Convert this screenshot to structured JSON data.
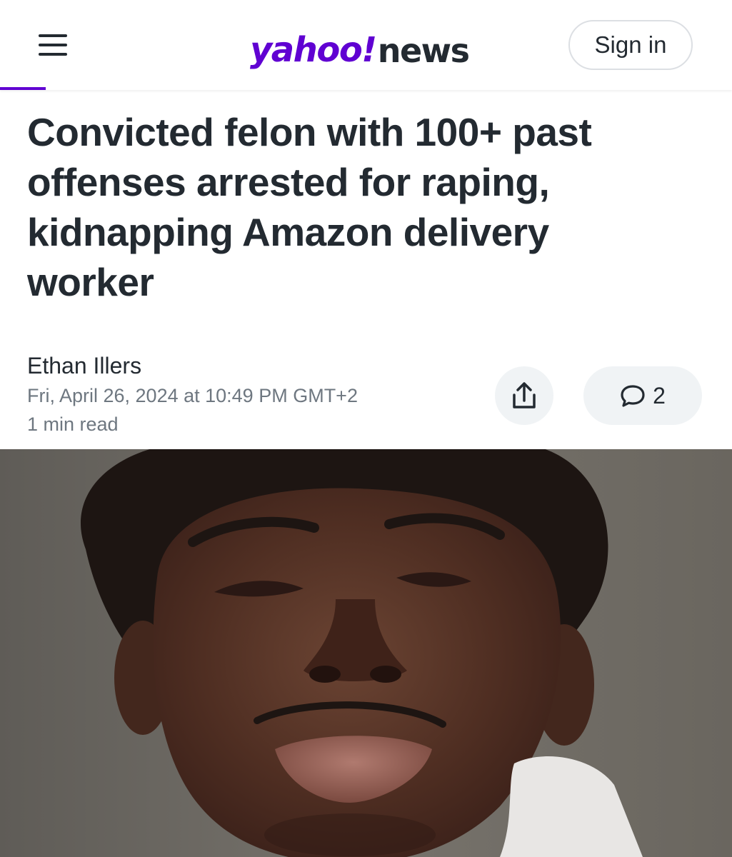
{
  "header": {
    "logo": {
      "brand": "yahoo!",
      "product": "news"
    },
    "sign_in_label": "Sign in"
  },
  "article": {
    "headline": "Convicted felon with 100+ past offenses arrested for raping, kidnapping Amazon delivery worker",
    "author": "Ethan Illers",
    "published": "Fri, April 26, 2024 at 10:49 PM GMT+2",
    "read_time": "1 min read",
    "comment_count": "2",
    "image": {
      "description_icon": "mugshot-photo"
    }
  },
  "icons": {
    "menu": "menu-icon",
    "share": "share-icon",
    "comment": "comment-icon"
  },
  "colors": {
    "brand": "#6001d2",
    "text": "#232a31",
    "meta": "#6e7780",
    "button_bg": "#f0f3f5"
  }
}
